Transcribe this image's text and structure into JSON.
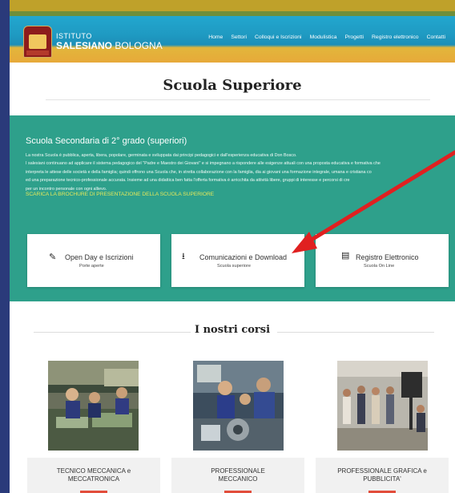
{
  "header": {
    "logo_line1": "ISTITUTO",
    "logo_line2_bold": "SALESIANO",
    "logo_line2_thin": "BOLOGNA",
    "nav": [
      "Home",
      "Settori",
      "Colloqui e Iscrizioni",
      "Modulistica",
      "Progetti",
      "Registro elettronico",
      "Contatti"
    ]
  },
  "page": {
    "title": "Scuola Superiore"
  },
  "intro": {
    "heading": "Scuola Secondaria di 2° grado (superiori)",
    "lines": [
      "La nostra Scuola è pubblica, aperta, libera, popolare, germinata e sviluppata dai principi pedagogici e dall'esperienza educativa di Don Bosco.",
      "I salesiani continuano ad applicare il sistema pedagogico del \"Padre e Maestro dei Giovani\" e si impegnano a rispondere alle esigenze attuali con una proposta educativa e formativa che",
      "interpreta le attese delle società e della famiglia; quindi offrono una Scuola che, in stretta collaborazione con la famiglia, dia ai giovani una formazione integrale, umana e cristiana co",
      "ed una preparazione tecnico-professionale accurata. Insieme ad una didattica ben fatta l'offerta formativa è arricchita da attività libere, gruppi di interesse e percorsi di cre",
      "per un incontro personale con ogni allievo."
    ],
    "brochure_link": "SCARICA LA BROCHURE DI PRESENTAZIONE DELLA SCUOLA SUPERIORE"
  },
  "cards": [
    {
      "icon": "pencil-icon",
      "glyph": "✎",
      "label": "Open Day e Iscrizioni",
      "sub": "Porte aperte"
    },
    {
      "icon": "download-icon",
      "glyph": "⭳",
      "label": "Comunicazioni e Download",
      "sub": "Scuola superiore"
    },
    {
      "icon": "document-icon",
      "glyph": "▤",
      "label": "Registro Elettronico",
      "sub": "Scuola On Line"
    }
  ],
  "courses": {
    "title": "I nostri corsi",
    "items": [
      {
        "line1": "TECNICO MECCANICA e",
        "line2": "MECCATRONICA"
      },
      {
        "line1": "PROFESSIONALE",
        "line2": "MECCANICO"
      },
      {
        "line1": "PROFESSIONALE GRAFICA e",
        "line2": "PUBBLICITA'"
      }
    ]
  },
  "colors": {
    "teal": "#2ea08b",
    "header_blue": "#1f9ac2",
    "header_orange": "#e7a93a",
    "link_yellow": "#e6e95a",
    "arrow_red": "#e02020",
    "accent_red": "#e24d3b"
  }
}
